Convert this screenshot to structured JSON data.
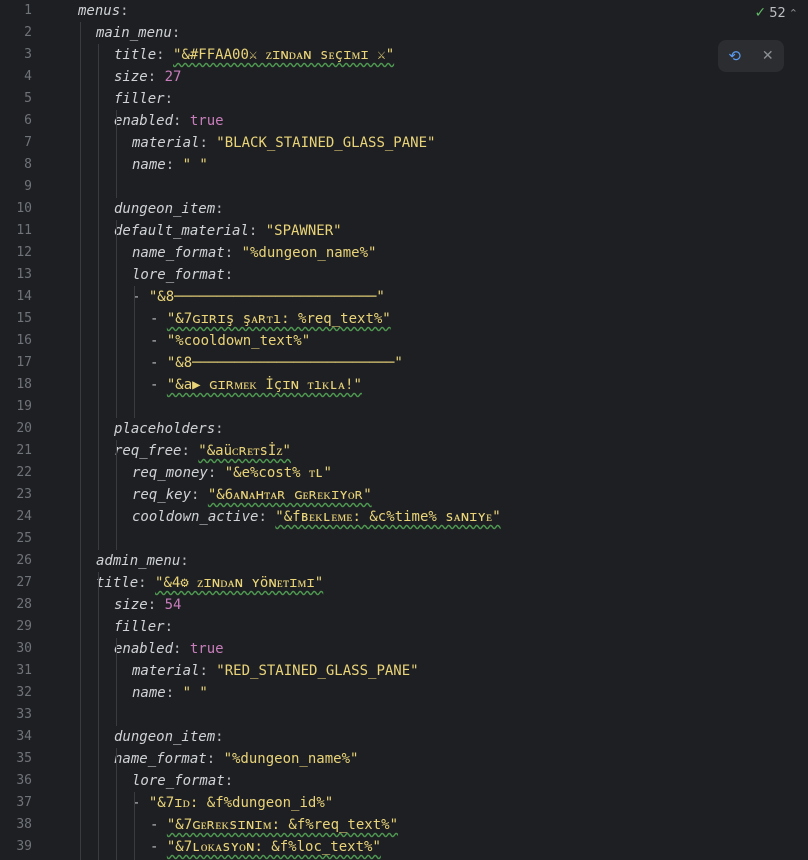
{
  "inspection": {
    "count": "52",
    "check_icon": "check-icon",
    "chevron_icon": "chevron-up-icon"
  },
  "toolbar": {
    "reload_icon": "reload-gradle-icon",
    "close_icon": "close-icon"
  },
  "lines": [
    {
      "n": "1",
      "tokens": [
        {
          "t": "key",
          "v": "menus"
        },
        {
          "t": "punc",
          "v": ":"
        }
      ]
    },
    {
      "n": "2",
      "tokens": [
        {
          "t": "key",
          "v": "main_menu"
        },
        {
          "t": "punc",
          "v": ":"
        }
      ]
    },
    {
      "n": "3",
      "tokens": [
        {
          "t": "key",
          "v": "title"
        },
        {
          "t": "punc",
          "v": ": "
        },
        {
          "t": "str",
          "v": "\"&#FFAA00⚔ ᴢɪɴᴅᴀɴ ѕᴇçɪᴍɪ ⚔\""
        }
      ]
    },
    {
      "n": "4",
      "tokens": [
        {
          "t": "key",
          "v": "size"
        },
        {
          "t": "punc",
          "v": ": "
        },
        {
          "t": "num",
          "v": "27"
        }
      ]
    },
    {
      "n": "5",
      "tokens": [
        {
          "t": "key",
          "v": "filler"
        },
        {
          "t": "punc",
          "v": ":"
        }
      ]
    },
    {
      "n": "6",
      "tokens": [
        {
          "t": "key",
          "v": "enabled"
        },
        {
          "t": "punc",
          "v": ": "
        },
        {
          "t": "kw",
          "v": "true"
        }
      ]
    },
    {
      "n": "7",
      "tokens": [
        {
          "t": "key",
          "v": "material"
        },
        {
          "t": "punc",
          "v": ": "
        },
        {
          "t": "str",
          "v": "\"BLACK_STAINED_GLASS_PANE\""
        }
      ]
    },
    {
      "n": "8",
      "tokens": [
        {
          "t": "key",
          "v": "name"
        },
        {
          "t": "punc",
          "v": ": "
        },
        {
          "t": "str",
          "v": "\" \""
        }
      ]
    },
    {
      "n": "9",
      "tokens": []
    },
    {
      "n": "10",
      "tokens": [
        {
          "t": "key",
          "v": "dungeon_item"
        },
        {
          "t": "punc",
          "v": ":"
        }
      ]
    },
    {
      "n": "11",
      "tokens": [
        {
          "t": "key",
          "v": "default_material"
        },
        {
          "t": "punc",
          "v": ": "
        },
        {
          "t": "str",
          "v": "\"SPAWNER\""
        }
      ]
    },
    {
      "n": "12",
      "tokens": [
        {
          "t": "key",
          "v": "name_format"
        },
        {
          "t": "punc",
          "v": ": "
        },
        {
          "t": "str",
          "v": "\"%dungeon_name%\""
        }
      ]
    },
    {
      "n": "13",
      "tokens": [
        {
          "t": "key",
          "v": "lore_format"
        },
        {
          "t": "punc",
          "v": ":"
        }
      ]
    },
    {
      "n": "14",
      "tokens": [
        {
          "t": "dash",
          "v": "- "
        },
        {
          "t": "str",
          "v": "\"&8────────────────────────\""
        }
      ]
    },
    {
      "n": "15",
      "tokens": [
        {
          "t": "dash",
          "v": "- "
        },
        {
          "t": "str",
          "v": "\"&7ɢɪʀɪş şᴀʀᴛı: %req_text%\""
        }
      ]
    },
    {
      "n": "16",
      "tokens": [
        {
          "t": "dash",
          "v": "- "
        },
        {
          "t": "str",
          "v": "\"%cooldown_text%\""
        }
      ]
    },
    {
      "n": "17",
      "tokens": [
        {
          "t": "dash",
          "v": "- "
        },
        {
          "t": "str",
          "v": "\"&8────────────────────────\""
        }
      ]
    },
    {
      "n": "18",
      "tokens": [
        {
          "t": "dash",
          "v": "- "
        },
        {
          "t": "str",
          "v": "\"&a▶ ɢɪʀᴍᴇᴋ İçɪɴ ᴛıᴋʟᴀ!\""
        }
      ]
    },
    {
      "n": "19",
      "tokens": []
    },
    {
      "n": "20",
      "tokens": [
        {
          "t": "key",
          "v": "placeholders"
        },
        {
          "t": "punc",
          "v": ":"
        }
      ]
    },
    {
      "n": "21",
      "tokens": [
        {
          "t": "key",
          "v": "req_free"
        },
        {
          "t": "punc",
          "v": ": "
        },
        {
          "t": "str",
          "v": "\"&aüᴄʀᴇᴛѕİᴢ\""
        }
      ]
    },
    {
      "n": "22",
      "tokens": [
        {
          "t": "key",
          "v": "req_money"
        },
        {
          "t": "punc",
          "v": ": "
        },
        {
          "t": "str",
          "v": "\"&e%cost% ᴛʟ\""
        }
      ]
    },
    {
      "n": "23",
      "tokens": [
        {
          "t": "key",
          "v": "req_key"
        },
        {
          "t": "punc",
          "v": ": "
        },
        {
          "t": "str",
          "v": "\"&6ᴀɴᴀʜᴛᴀʀ ɢᴇʀᴇᴋɪʏᴏʀ\""
        }
      ]
    },
    {
      "n": "24",
      "tokens": [
        {
          "t": "key",
          "v": "cooldown_active"
        },
        {
          "t": "punc",
          "v": ": "
        },
        {
          "t": "str",
          "v": "\"&fʙᴇᴋʟᴇᴍᴇ: &c%time% ѕᴀɴɪʏᴇ\""
        }
      ]
    },
    {
      "n": "25",
      "tokens": []
    },
    {
      "n": "26",
      "tokens": [
        {
          "t": "key",
          "v": "admin_menu"
        },
        {
          "t": "punc",
          "v": ":"
        }
      ]
    },
    {
      "n": "27",
      "tokens": [
        {
          "t": "key",
          "v": "title"
        },
        {
          "t": "punc",
          "v": ": "
        },
        {
          "t": "str",
          "v": "\"&4⚙ ᴢɪɴᴅᴀɴ ʏöɴᴇᴛɪᴍɪ\""
        }
      ]
    },
    {
      "n": "28",
      "tokens": [
        {
          "t": "key",
          "v": "size"
        },
        {
          "t": "punc",
          "v": ": "
        },
        {
          "t": "num",
          "v": "54"
        }
      ]
    },
    {
      "n": "29",
      "tokens": [
        {
          "t": "key",
          "v": "filler"
        },
        {
          "t": "punc",
          "v": ":"
        }
      ]
    },
    {
      "n": "30",
      "tokens": [
        {
          "t": "key",
          "v": "enabled"
        },
        {
          "t": "punc",
          "v": ": "
        },
        {
          "t": "kw",
          "v": "true"
        }
      ]
    },
    {
      "n": "31",
      "tokens": [
        {
          "t": "key",
          "v": "material"
        },
        {
          "t": "punc",
          "v": ": "
        },
        {
          "t": "str",
          "v": "\"RED_STAINED_GLASS_PANE\""
        }
      ]
    },
    {
      "n": "32",
      "tokens": [
        {
          "t": "key",
          "v": "name"
        },
        {
          "t": "punc",
          "v": ": "
        },
        {
          "t": "str",
          "v": "\" \""
        }
      ]
    },
    {
      "n": "33",
      "tokens": []
    },
    {
      "n": "34",
      "tokens": [
        {
          "t": "key",
          "v": "dungeon_item"
        },
        {
          "t": "punc",
          "v": ":"
        }
      ]
    },
    {
      "n": "35",
      "tokens": [
        {
          "t": "key",
          "v": "name_format"
        },
        {
          "t": "punc",
          "v": ": "
        },
        {
          "t": "str",
          "v": "\"%dungeon_name%\""
        }
      ]
    },
    {
      "n": "36",
      "tokens": [
        {
          "t": "key",
          "v": "lore_format"
        },
        {
          "t": "punc",
          "v": ":"
        }
      ]
    },
    {
      "n": "37",
      "tokens": [
        {
          "t": "dash",
          "v": "- "
        },
        {
          "t": "str",
          "v": "\"&7ɪᴅ: &f%dungeon_id%\""
        }
      ]
    },
    {
      "n": "38",
      "tokens": [
        {
          "t": "dash",
          "v": "- "
        },
        {
          "t": "str",
          "v": "\"&7ɢᴇʀᴇᴋѕɪɴɪᴍ: &f%req_text%\""
        }
      ]
    },
    {
      "n": "39",
      "tokens": [
        {
          "t": "dash",
          "v": "- "
        },
        {
          "t": "str",
          "v": "\"&7ʟᴏᴋᴀѕʏᴏɴ: &f%loc_text%\""
        }
      ]
    }
  ]
}
